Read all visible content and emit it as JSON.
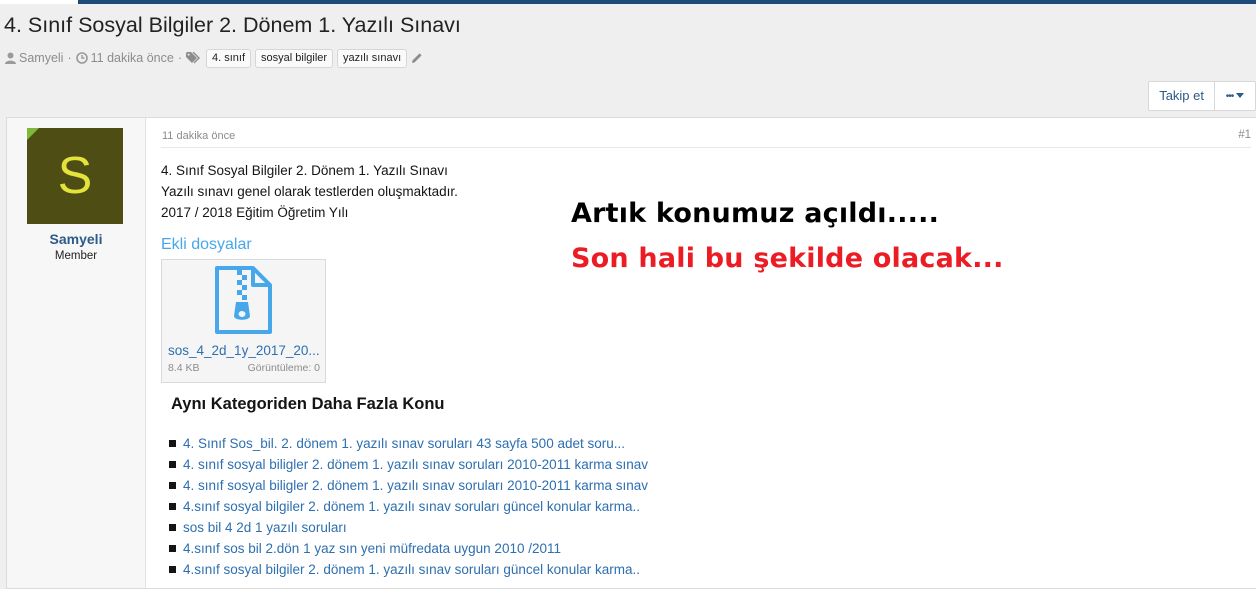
{
  "thread": {
    "title": "4. Sınıf Sosyal Bilgiler 2. Dönem 1. Yazılı Sınavı",
    "author": "Samyeli",
    "time_ago": "11 dakika önce",
    "separator": "·",
    "tags": [
      "4. sınıf",
      "sosyal bilgiler",
      "yazılı sınavı"
    ]
  },
  "actions": {
    "follow_label": "Takip et",
    "more_label": "•••"
  },
  "post": {
    "user": {
      "name": "Samyeli",
      "role": "Member",
      "avatar_letter": "S"
    },
    "time": "11 dakika önce",
    "number": "#1",
    "lines": [
      "4. Sınıf Sosyal Bilgiler 2. Dönem 1. Yazılı Sınavı",
      "Yazılı sınavı genel olarak testlerden oluşmaktadır.",
      "2017 / 2018 Eğitim Öğretim Yılı"
    ],
    "attachments_heading": "Ekli dosyalar",
    "attachment": {
      "name": "sos_4_2d_1y_2017_20...",
      "size": "8.4 KB",
      "views": "Görüntüleme: 0"
    }
  },
  "overlay": {
    "line1": "Artık konumuz açıldı.....",
    "line2": "Son hali bu şekilde olacak..."
  },
  "related": {
    "title": "Aynı Kategoriden Daha Fazla Konu",
    "items": [
      "4. Sınıf Sos_bil. 2. dönem 1. yazılı sınav soruları 43 sayfa 500 adet soru...",
      "4. sınıf sosyal biligler 2. dönem 1. yazılı sınav soruları 2010-2011 karma sınav",
      "4. sınıf sosyal biligler 2. dönem 1. yazılı sınav soruları 2010-2011 karma sınav",
      "4.sınıf sosyal bilgiler 2. dönem 1. yazılı sınav soruları güncel konular karma..",
      "sos bil 4 2d 1 yazılı soruları",
      "4.sınıf sos bil 2.dön 1 yaz sın yeni müfredata uygun 2010 /2011",
      "4.sınıf sosyal bilgiler 2. dönem 1. yazılı sınav soruları güncel konular karma.."
    ]
  },
  "colors": {
    "link": "#2d6fb0",
    "attachments_heading": "#47a7eb",
    "overlay_red": "#ec1c24",
    "avatar_bg": "#4e4d13",
    "avatar_letter": "#e3e33c"
  },
  "icons": [
    "user-icon",
    "clock-icon",
    "tags-icon",
    "pencil-icon",
    "zip-file-icon",
    "caret-down-icon"
  ]
}
